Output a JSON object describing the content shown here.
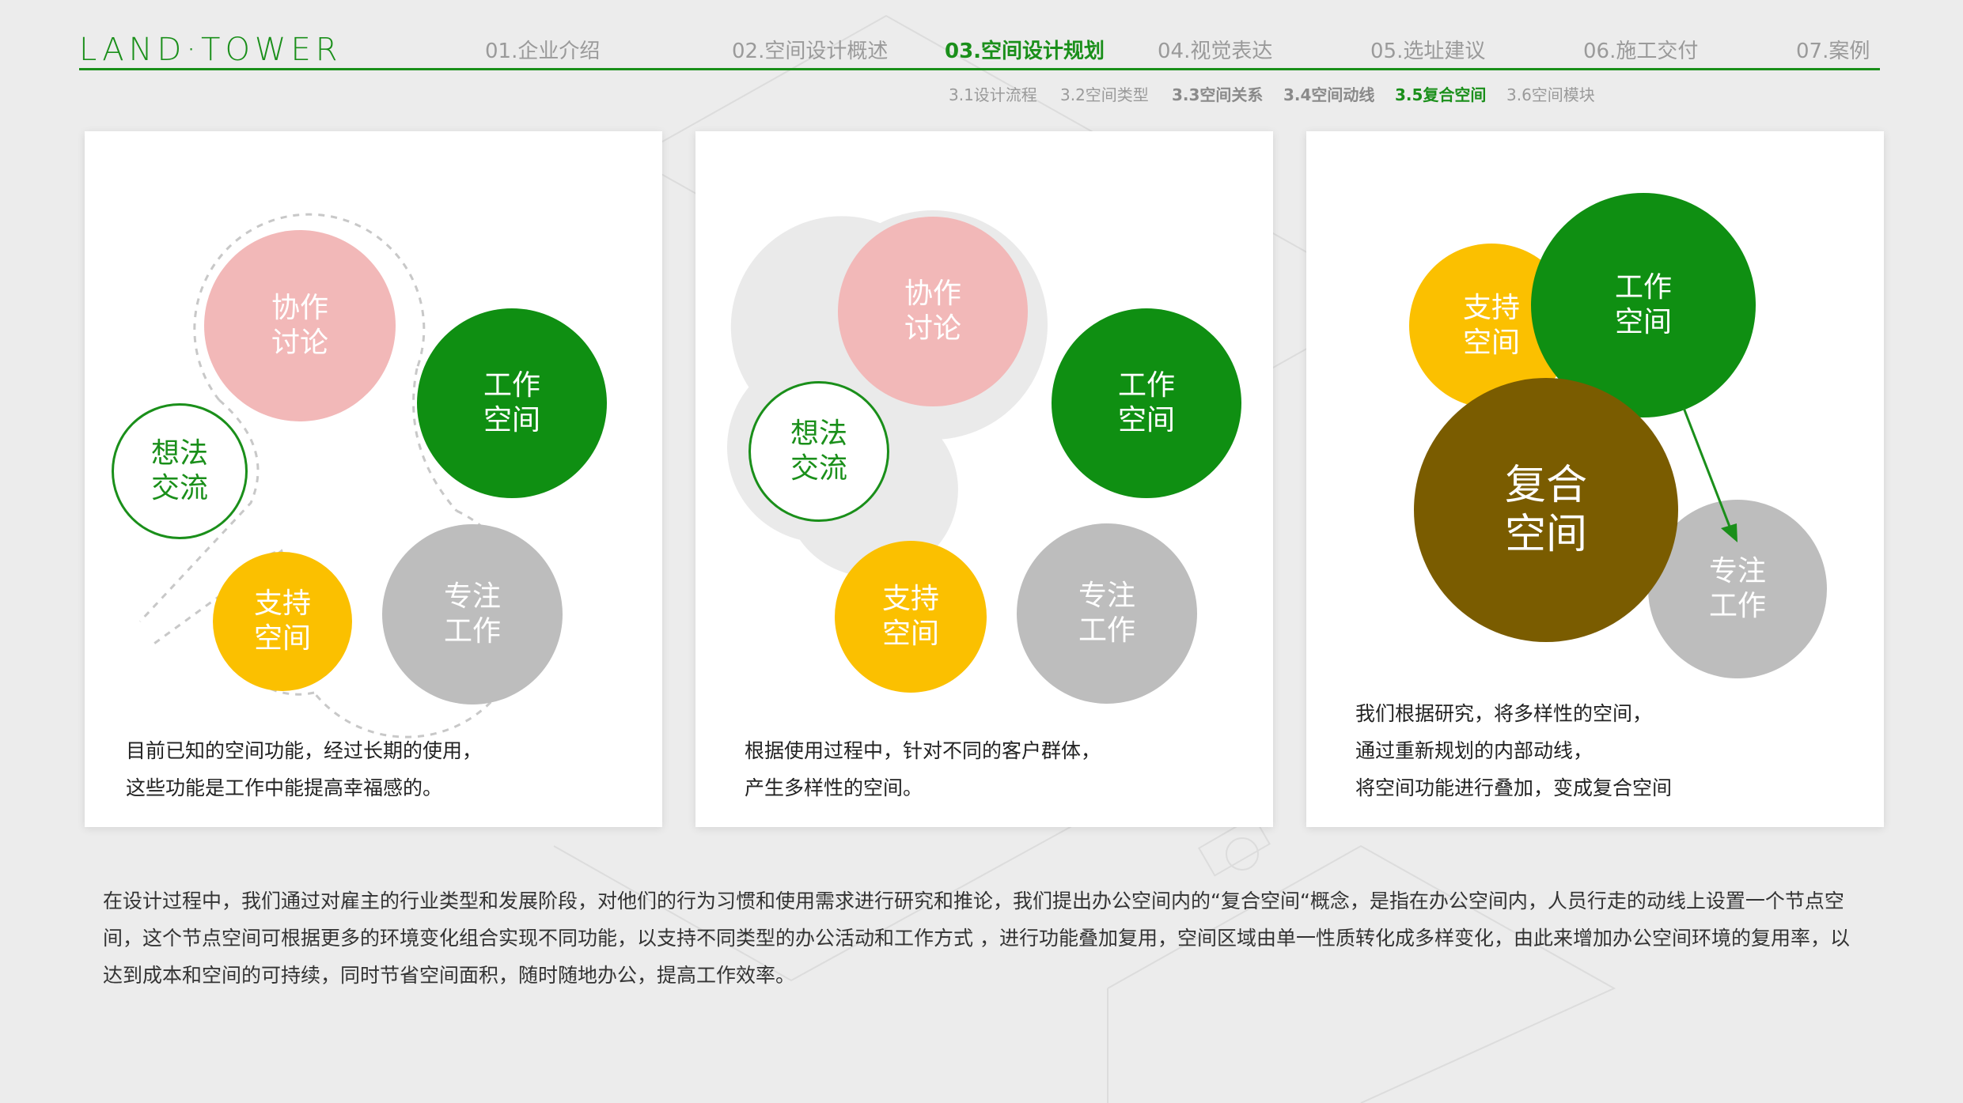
{
  "logo": "LAND·TOWER",
  "nav": [
    {
      "label": "01.企业介绍"
    },
    {
      "label": "02.空间设计概述"
    },
    {
      "label": "03.空间设计规划"
    },
    {
      "label": "04.视觉表达"
    },
    {
      "label": "05.选址建议"
    },
    {
      "label": "06.施工交付"
    },
    {
      "label": "07.案例"
    }
  ],
  "active_nav": "03.空间设计规划",
  "subnav": [
    {
      "label": "3.1设计流程"
    },
    {
      "label": "3.2空间类型"
    },
    {
      "label": "3.3空间关系"
    },
    {
      "label": "3.4空间动线"
    },
    {
      "label": "3.5复合空间"
    },
    {
      "label": "3.6空间模块"
    }
  ],
  "active_subnav": "3.5复合空间",
  "colors": {
    "brand_green": "#1a8f1a",
    "work_green": "#0f8f12",
    "pink": "#f2b8b8",
    "yellow": "#fbc000",
    "grey": "#bdbdbd",
    "brown": "#7a5c00"
  },
  "cards": [
    {
      "bubbles": {
        "collab": "协作讨论",
        "work": "工作空间",
        "ideas": "想法交流",
        "support": "支持空间",
        "focus": "专注工作"
      },
      "caption_lines": [
        "目前已知的空间功能，经过长期的使用，",
        "这些功能是工作中能提高幸福感的。"
      ]
    },
    {
      "bubbles": {
        "collab": "协作讨论",
        "work": "工作空间",
        "ideas": "想法交流",
        "support": "支持空间",
        "focus": "专注工作"
      },
      "caption_lines": [
        "根据使用过程中，针对不同的客户群体，",
        "产生多样性的空间。"
      ]
    },
    {
      "bubbles": {
        "support": "支持空间",
        "work": "工作空间",
        "composite": "复合空间",
        "focus": "专注工作"
      },
      "caption_lines": [
        "我们根据研究，将多样性的空间，",
        "通过重新规划的内部动线，",
        "将空间功能进行叠加，变成复合空间"
      ]
    }
  ],
  "summary": "在设计过程中，我们通过对雇主的行业类型和发展阶段，对他们的行为习惯和使用需求进行研究和推论，我们提出办公空间内的“复合空间“概念，是指在办公空间内，人员行走的动线上设置一个节点空间，这个节点空间可根据更多的环境变化组合实现不同功能，以支持不同类型的办公活动和工作方式 ，进行功能叠加复用，空间区域由单一性质转化成多样变化，由此来增加办公空间环境的复用率，以达到成本和空间的可持续，同时节省空间面积，随时随地办公，提高工作效率。"
}
